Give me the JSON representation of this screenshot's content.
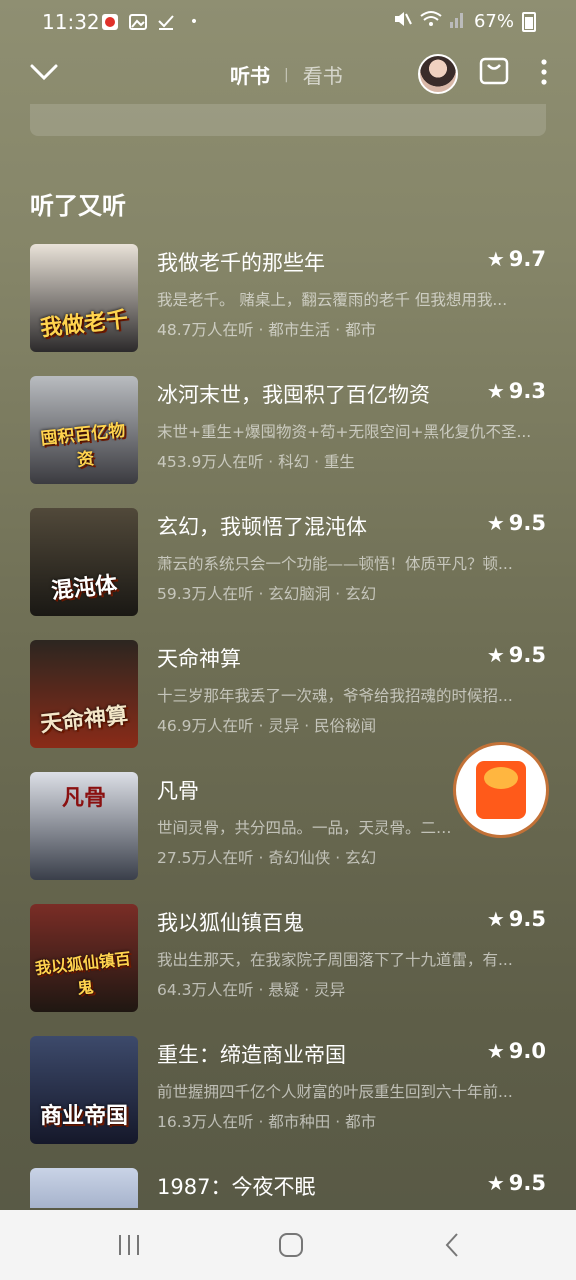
{
  "status_bar": {
    "time": "11:32",
    "battery": "67%"
  },
  "header": {
    "tab_listen": "听书",
    "tab_read": "看书"
  },
  "section": {
    "title": "听了又听"
  },
  "books": [
    {
      "title": "我做老千的那些年",
      "rating": "9.7",
      "desc": "我是老千。 赌桌上，翻云覆雨的老千 但我想用我...",
      "meta": "48.7万人在听 · 都市生活 · 都市",
      "cover_text": "我做老千",
      "cover_colors": [
        "#e9e2d8",
        "#2c2a2b"
      ]
    },
    {
      "title": "冰河末世，我囤积了百亿物资",
      "rating": "9.3",
      "desc": "末世+重生+爆囤物资+苟+无限空间+黑化复仇不圣...",
      "meta": "453.9万人在听 · 科幻 · 重生",
      "cover_text": "囤积百亿物资",
      "cover_colors": [
        "#b9bcc0",
        "#3b3b40"
      ]
    },
    {
      "title": "玄幻，我顿悟了混沌体",
      "rating": "9.5",
      "desc": "萧云的系统只会一个功能——顿悟！体质平凡？顿...",
      "meta": "59.3万人在听 · 玄幻脑洞 · 玄幻",
      "cover_text": "混沌体",
      "cover_colors": [
        "#51493a",
        "#1a1814"
      ]
    },
    {
      "title": "天命神算",
      "rating": "9.5",
      "desc": "十三岁那年我丢了一次魂，爷爷给我招魂的时候招...",
      "meta": "46.9万人在听 · 灵异 · 民俗秘闻",
      "cover_text": "天命神算",
      "cover_colors": [
        "#2c2620",
        "#8a2b18"
      ]
    },
    {
      "title": "凡骨",
      "rating": "",
      "desc": "世间灵骨，共分四品。一品，天灵骨。二品...",
      "meta": "27.5万人在听 · 奇幻仙侠 · 玄幻",
      "cover_text": "凡骨",
      "cover_colors": [
        "#dcdfe6",
        "#3a3f4a"
      ]
    },
    {
      "title": "我以狐仙镇百鬼",
      "rating": "9.5",
      "desc": "我出生那天，在我家院子周围落下了十九道雷，有...",
      "meta": "64.3万人在听 · 悬疑 · 灵异",
      "cover_text": "我以狐仙镇百鬼",
      "cover_colors": [
        "#7a2d26",
        "#1f1712"
      ]
    },
    {
      "title": "重生：缔造商业帝国",
      "rating": "9.0",
      "desc": "前世握拥四千亿个人财富的叶辰重生回到六十年前...",
      "meta": "16.3万人在听 · 都市种田 · 都市",
      "cover_text": "商业帝国",
      "cover_colors": [
        "#3d4a6b",
        "#15182a"
      ]
    },
    {
      "title": "1987：今夜不眠",
      "rating": "9.5",
      "desc": "",
      "meta": "",
      "cover_text": "",
      "cover_colors": [
        "#c9d3e6",
        "#6c7da0"
      ]
    }
  ]
}
